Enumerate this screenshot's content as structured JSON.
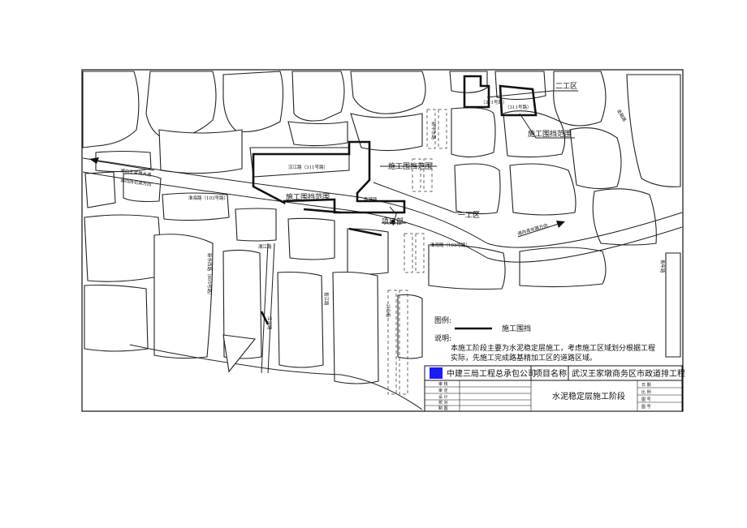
{
  "map": {
    "callouts": {
      "zone2": "二工区",
      "fence_top": "施工围挡范围",
      "fence_mid": "施工围挡范围",
      "fence_left": "施工围挡范围",
      "zone1": "一工区",
      "project_dept": "项目部"
    },
    "roads": {
      "r1": "汉江路（311号路）",
      "r2": "淮海路（103号路）",
      "r3": "淮海路（103号路）",
      "r4": "湘江路",
      "r5": "兴业街",
      "r6": "新华东路",
      "r7": "香江路",
      "r8": "新华西路（805号路）",
      "r9": "江汉路",
      "r10": "香港路",
      "r11": "（311号路）",
      "r12": "（311号路）",
      "r13": "通向王家墩大道",
      "r14": "通向西北湖方向",
      "r15": "通向青年路方向",
      "r16": "青年路",
      "r17": "金融路"
    },
    "legend": {
      "heading": "图例:",
      "item": "施工围挡"
    },
    "notes": {
      "heading": "说明:",
      "line1": "本施工阶段主要为水泥稳定层施工，考虑施工区域划分根据工程",
      "line2": "实际，先施工完成路基精加工区的道路区域。"
    }
  },
  "title_block": {
    "company": "中建三局工程总承包公司",
    "project_label": "项目名称",
    "project_name": "武汉王家墩商务区市政道排工程",
    "drawing_title": "水泥稳定层施工阶段",
    "left_rows": [
      "审 核",
      "审 定",
      "设 计",
      "校 对",
      "制 图"
    ],
    "right_rows": [
      "日 期",
      "比 例",
      "图 号",
      "图 号"
    ],
    "logo_color": "#1a1aff"
  }
}
